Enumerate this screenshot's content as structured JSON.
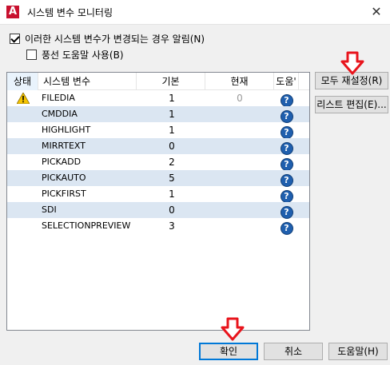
{
  "window": {
    "title": "시스템 변수 모니터링",
    "close_glyph": "✕",
    "app_icon_letter": "A"
  },
  "options": {
    "notify_label": "이러한 시스템 변수가 변경되는 경우 알림(N)",
    "notify_checked": true,
    "balloon_label": "풍선 도움말 사용(B)",
    "balloon_checked": false
  },
  "list": {
    "columns": {
      "status": "상태",
      "name": "시스템 변수",
      "basic": "기본",
      "current": "현재",
      "help": "도움'"
    },
    "rows": [
      {
        "status": "warning-icon",
        "name": "FILEDIA",
        "basic": "1",
        "current": "0",
        "help": "?"
      },
      {
        "status": "",
        "name": "CMDDIA",
        "basic": "1",
        "current": "",
        "help": "?"
      },
      {
        "status": "",
        "name": "HIGHLIGHT",
        "basic": "1",
        "current": "",
        "help": "?"
      },
      {
        "status": "",
        "name": "MIRRTEXT",
        "basic": "0",
        "current": "",
        "help": "?"
      },
      {
        "status": "",
        "name": "PICKADD",
        "basic": "2",
        "current": "",
        "help": "?"
      },
      {
        "status": "",
        "name": "PICKAUTO",
        "basic": "5",
        "current": "",
        "help": "?"
      },
      {
        "status": "",
        "name": "PICKFIRST",
        "basic": "1",
        "current": "",
        "help": "?"
      },
      {
        "status": "",
        "name": "SDI",
        "basic": "0",
        "current": "",
        "help": "?"
      },
      {
        "status": "",
        "name": "SELECTIONPREVIEW",
        "basic": "3",
        "current": "",
        "help": "?"
      }
    ]
  },
  "buttons": {
    "reset_all": "모두 재설정(R)",
    "edit_list": "리스트 편집(E)...",
    "ok": "확인",
    "cancel": "취소",
    "help": "도움말(H)"
  },
  "colors": {
    "alt_row": "#dbe6f2",
    "annotation_arrow": "#e8141c",
    "help_icon": "#1f5fae",
    "warning_icon": "#f5c400"
  }
}
